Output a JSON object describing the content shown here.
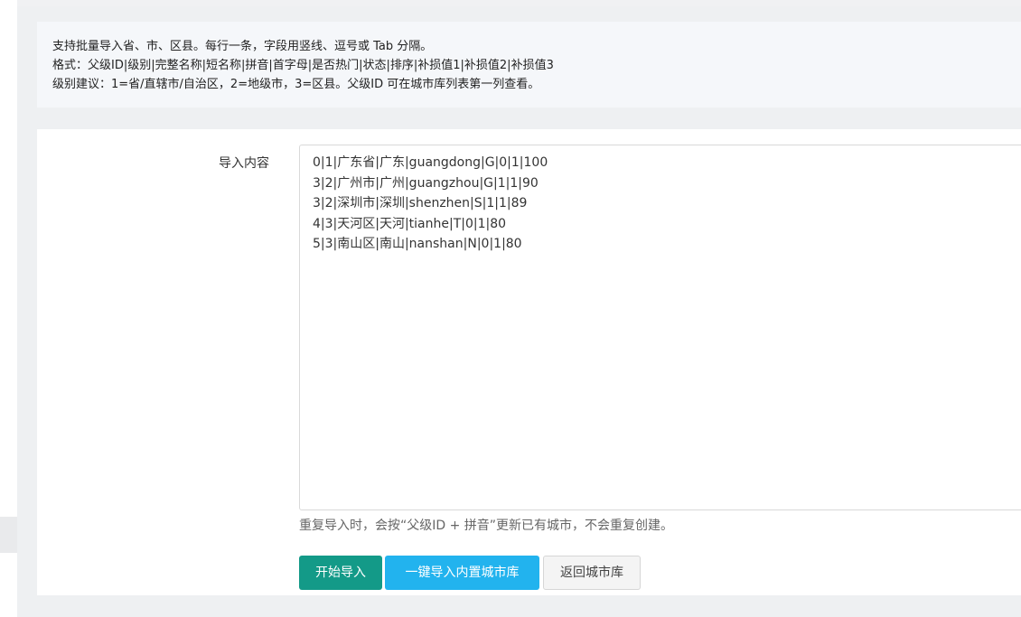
{
  "tips": {
    "line1": "支持批量导入省、市、区县。每行一条，字段用竖线、逗号或 Tab 分隔。",
    "line2": "格式：父级ID|级别|完整名称|短名称|拼音|首字母|是否热门|状态|排序|补损值1|补损值2|补损值3",
    "line3": "级别建议：1=省/直辖市/自治区，2=地级市，3=区县。父级ID 可在城市库列表第一列查看。"
  },
  "form": {
    "label": "导入内容",
    "content": "0|1|广东省|广东|guangdong|G|0|1|100\n3|2|广州市|广州|guangzhou|G|1|1|90\n3|2|深圳市|深圳|shenzhen|S|1|1|89\n4|3|天河区|天河|tianhe|T|0|1|80\n5|3|南山区|南山|nanshan|N|0|1|80",
    "help": "重复导入时，会按“父级ID + 拼音”更新已有城市，不会重复创建。"
  },
  "buttons": {
    "start_import": "开始导入",
    "import_builtin": "一键导入内置城市库",
    "back": "返回城市库"
  }
}
